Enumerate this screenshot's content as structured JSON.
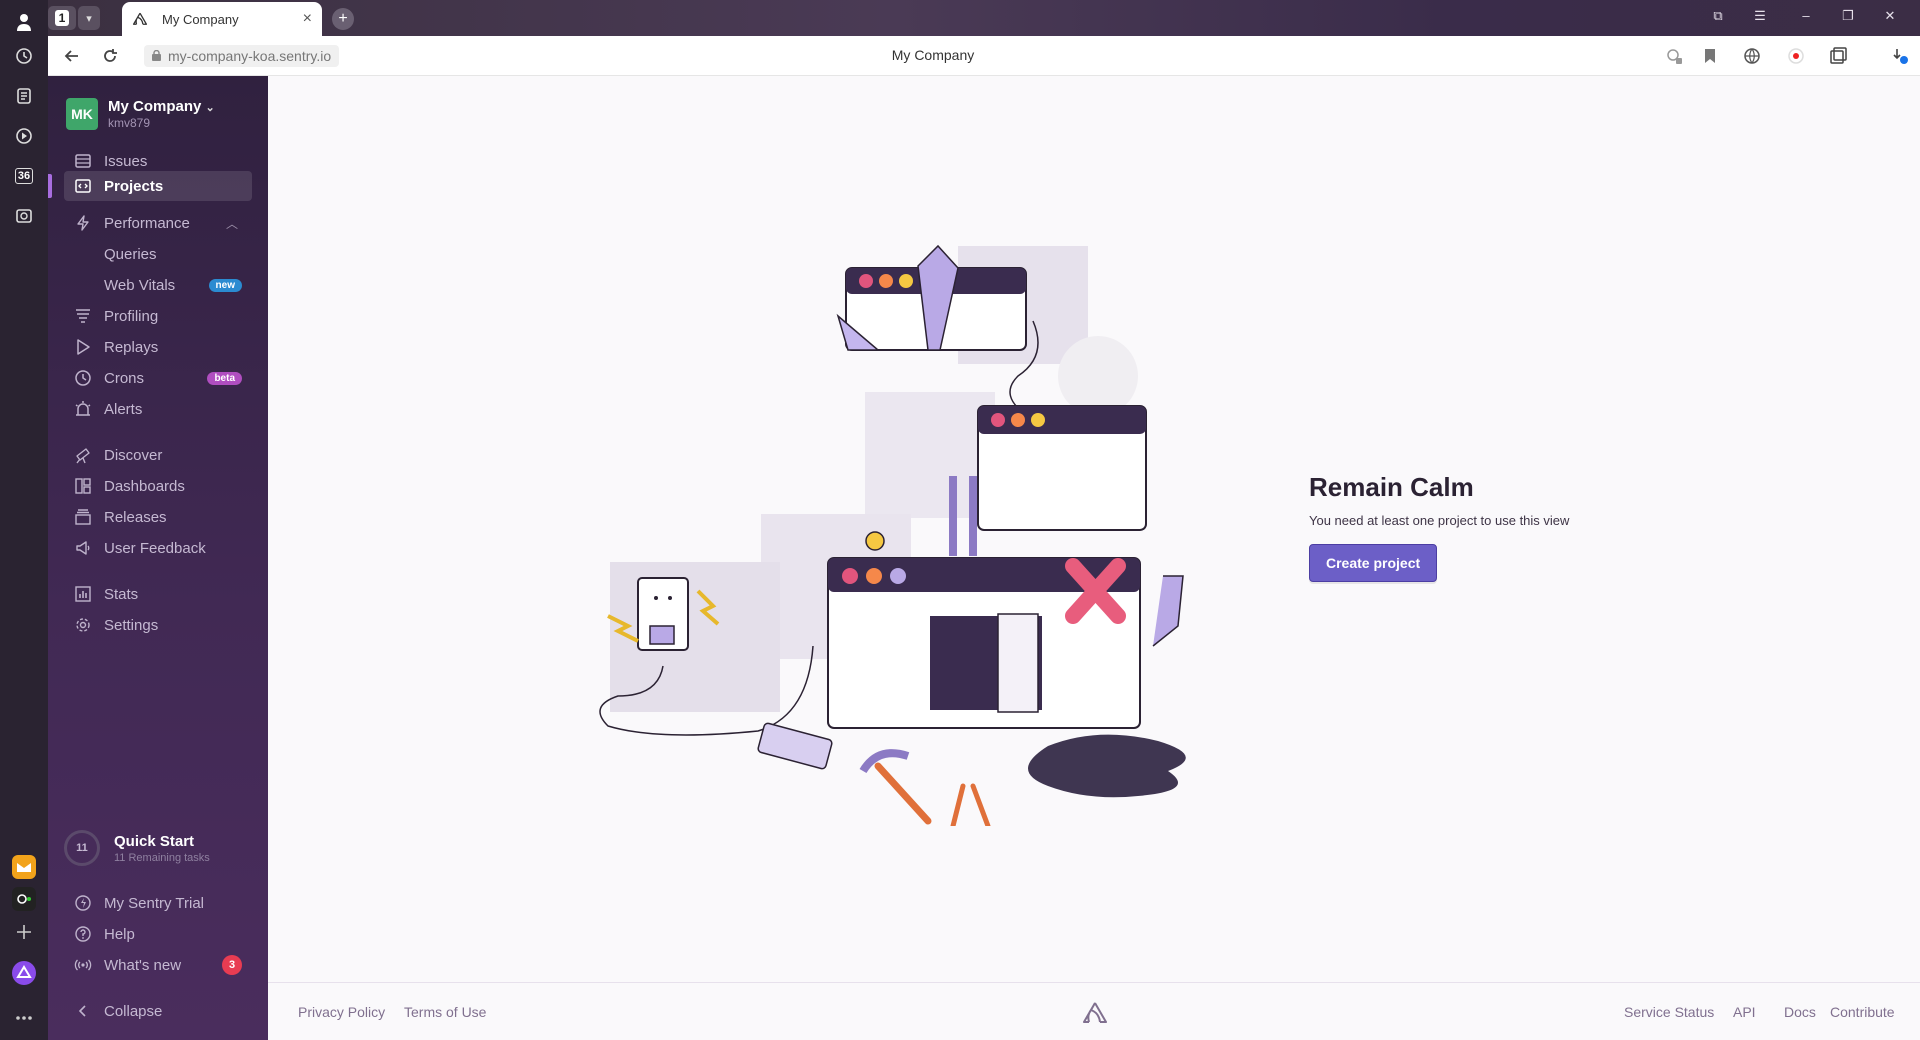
{
  "browser": {
    "tab_count": "1",
    "tab_title": "My Company",
    "url": "my-company-koa.sentry.io",
    "page_title": "My Company",
    "rail_badge": "36"
  },
  "sidebar": {
    "org_initials": "MK",
    "org_name": "My Company",
    "org_user": "kmv879",
    "items": [
      {
        "label": "Issues"
      },
      {
        "label": "Projects"
      },
      {
        "label": "Performance"
      },
      {
        "label": "Queries"
      },
      {
        "label": "Web Vitals",
        "badge": "new"
      },
      {
        "label": "Profiling"
      },
      {
        "label": "Replays"
      },
      {
        "label": "Crons",
        "badge": "beta"
      },
      {
        "label": "Alerts"
      },
      {
        "label": "Discover"
      },
      {
        "label": "Dashboards"
      },
      {
        "label": "Releases"
      },
      {
        "label": "User Feedback"
      },
      {
        "label": "Stats"
      },
      {
        "label": "Settings"
      }
    ],
    "quick_start": {
      "count": "11",
      "title": "Quick Start",
      "subtitle": "11 Remaining tasks"
    },
    "bottom": [
      {
        "label": "My Sentry Trial"
      },
      {
        "label": "Help"
      },
      {
        "label": "What's new",
        "count": "3"
      },
      {
        "label": "Collapse"
      }
    ]
  },
  "main": {
    "title": "Remain Calm",
    "message": "You need at least one project to use this view",
    "button": "Create project"
  },
  "footer": {
    "left": [
      "Privacy Policy",
      "Terms of Use"
    ],
    "right": [
      "Service Status",
      "API",
      "Docs",
      "Contribute"
    ]
  },
  "colors": {
    "accent": "#6c5fc7",
    "sidebar": "#3a2650",
    "badge_new": "#2b8bd1",
    "badge_beta": "#b04ec0",
    "alert": "#e83c52"
  }
}
